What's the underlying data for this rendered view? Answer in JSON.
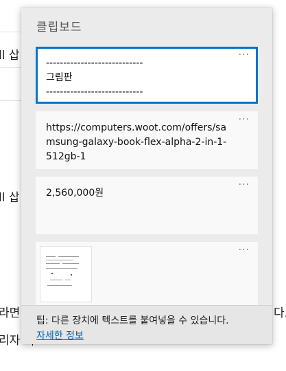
{
  "document": {
    "fragments": [
      "ll 삽",
      "ll 삽",
      "라면",
      "다.",
      "리자"
    ]
  },
  "clipboard": {
    "title": "클립보드",
    "more_glyph": "···",
    "items": [
      {
        "text": "----------------------------\n그림판\n----------------------------"
      },
      {
        "text": "https://computers.woot.com/offers/samsung-galaxy-book-flex-alpha-2-in-1-512gb-1"
      },
      {
        "text": "2,560,000원"
      },
      {
        "text": ""
      }
    ],
    "footer": {
      "tip": "팁: 다른 장치에 텍스트를 붙여넣을 수 있습니다.",
      "more_info": "자세한 정보"
    }
  },
  "colors": {
    "accent": "#0a74c9",
    "link": "#0063b1",
    "panel_bg": "#ebebeb"
  }
}
